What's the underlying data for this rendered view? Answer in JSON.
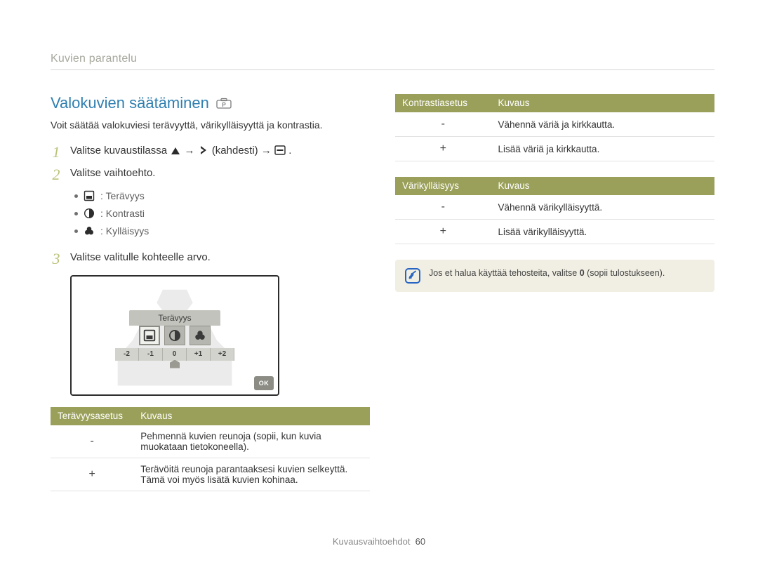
{
  "page_header": "Kuvien parantelu",
  "section_title": "Valokuvien säätäminen",
  "intro": "Voit säätää valokuviesi terävyyttä, värikylläisyyttä ja kontrastia.",
  "steps": {
    "s1_num": "1",
    "s1_pre": "Valitse kuvaustilassa ",
    "s1_mid": " (kahdesti) ",
    "s1_end": ".",
    "arrow": "→",
    "s2_num": "2",
    "s2_text": "Valitse vaihtoehto.",
    "s3_num": "3",
    "s3_text": "Valitse valitulle kohteelle arvo."
  },
  "options": {
    "sharpness": ": Terävyys",
    "contrast": ": Kontrasti",
    "saturation": ": Kylläisyys"
  },
  "illustration": {
    "bar_label": "Terävyys",
    "scale": [
      "-2",
      "-1",
      "0",
      "+1",
      "+2"
    ],
    "ok": "OK"
  },
  "sharp_table": {
    "h1": "Terävyysasetus",
    "h2": "Kuvaus",
    "r1_sign": "-",
    "r1_desc": "Pehmennä kuvien reunoja (sopii, kun kuvia muokataan tietokoneella).",
    "r2_sign": "+",
    "r2_desc": "Terävöitä reunoja parantaaksesi kuvien selkeyttä. Tämä voi myös lisätä kuvien kohinaa."
  },
  "contrast_table": {
    "h1": "Kontrastiasetus",
    "h2": "Kuvaus",
    "r1_sign": "-",
    "r1_desc": "Vähennä väriä ja kirkkautta.",
    "r2_sign": "+",
    "r2_desc": "Lisää väriä ja kirkkautta."
  },
  "sat_table": {
    "h1": "Värikylläisyys",
    "h2": "Kuvaus",
    "r1_sign": "-",
    "r1_desc": "Vähennä värikylläisyyttä.",
    "r2_sign": "+",
    "r2_desc": "Lisää värikylläisyyttä."
  },
  "callout": {
    "pre": "Jos et halua käyttää tehosteita, valitse ",
    "bold": "0",
    "post": " (sopii tulostukseen)."
  },
  "footer": {
    "section": "Kuvausvaihtoehdot",
    "page": "60"
  }
}
